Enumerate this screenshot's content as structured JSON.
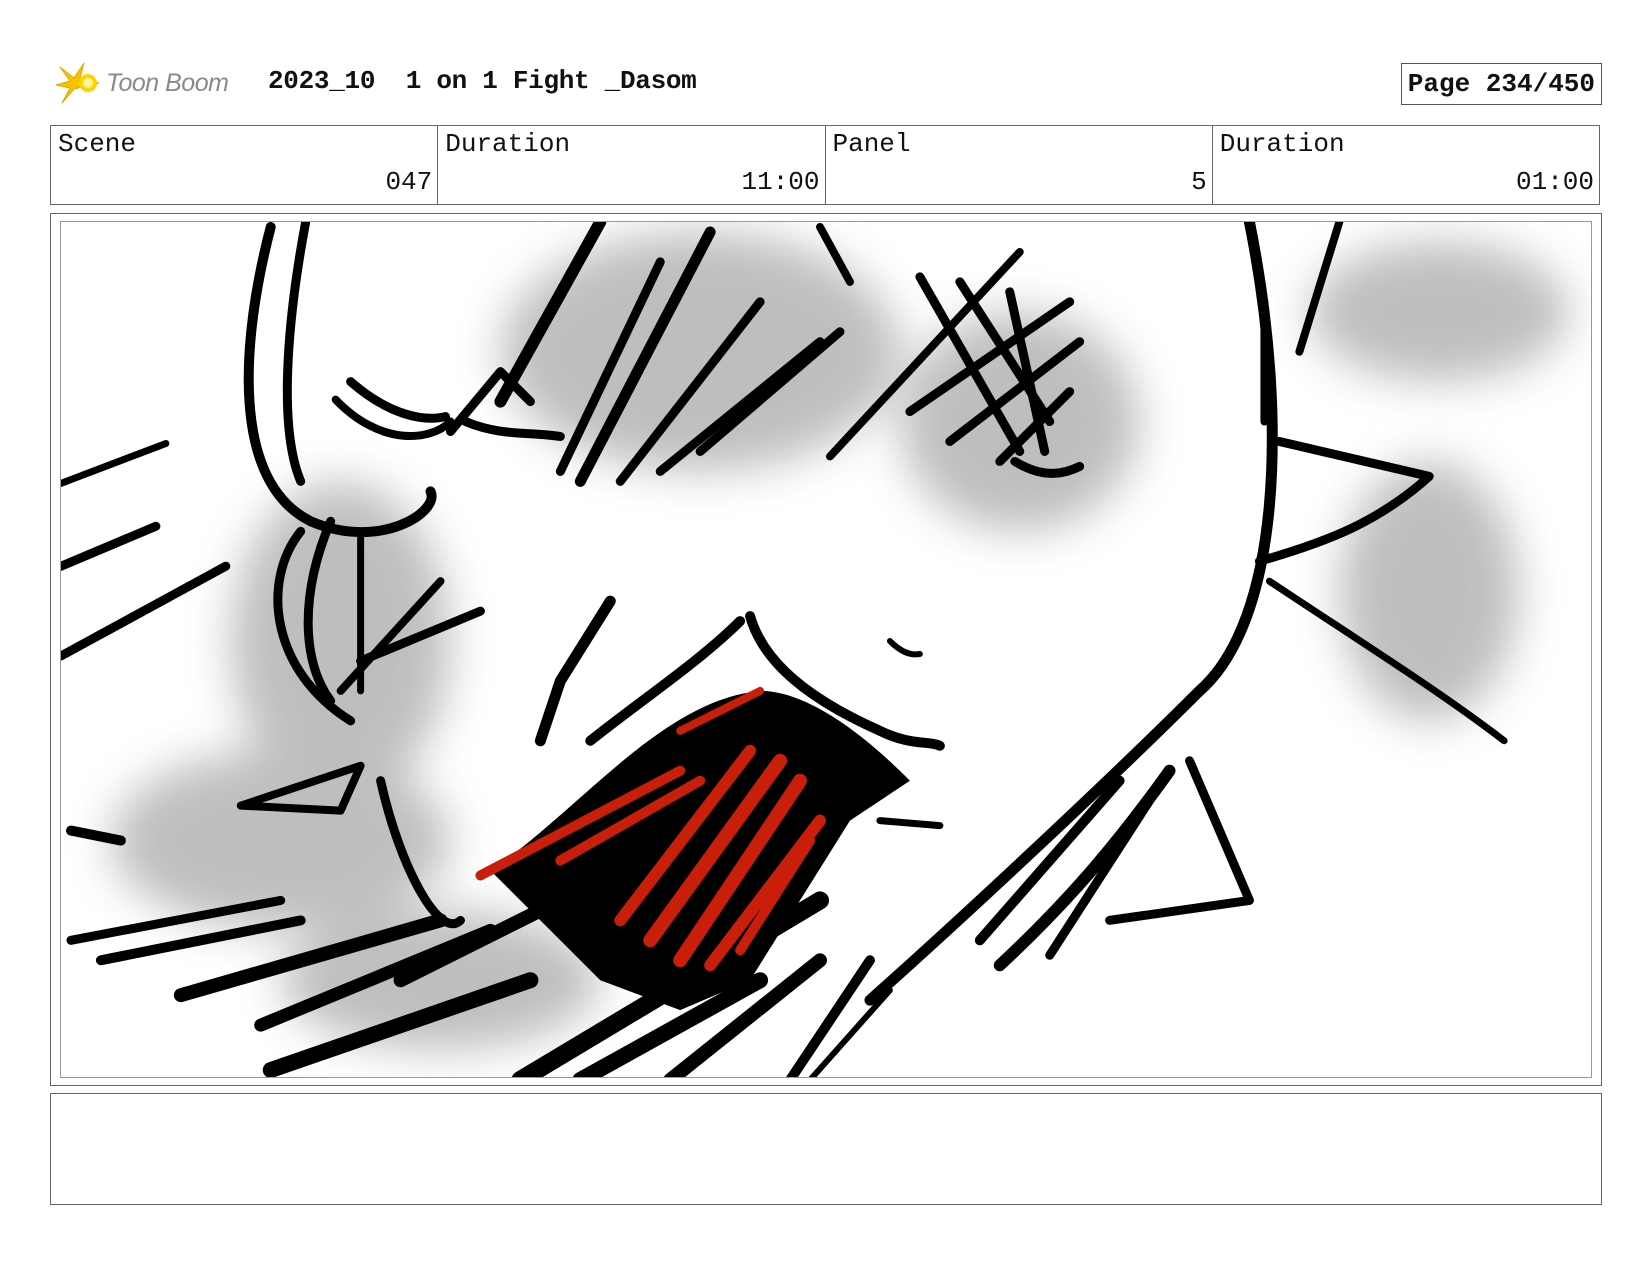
{
  "header": {
    "logo_text": "Toon Boom",
    "project_title": "2023_10  1 on 1 Fight _Dasom",
    "page_label": "Page 234/450"
  },
  "info": {
    "scene_label": "Scene",
    "scene_value": "047",
    "scene_duration_label": "Duration",
    "scene_duration_value": "11:00",
    "panel_label": "Panel",
    "panel_value": "5",
    "panel_duration_label": "Duration",
    "panel_duration_value": "01:00"
  },
  "colors": {
    "ink": "#000000",
    "accent_red": "#c81e0a",
    "shadow_gray": "#8a8a8a",
    "logo_yellow": "#f5c400"
  },
  "notes": {
    "text": ""
  }
}
